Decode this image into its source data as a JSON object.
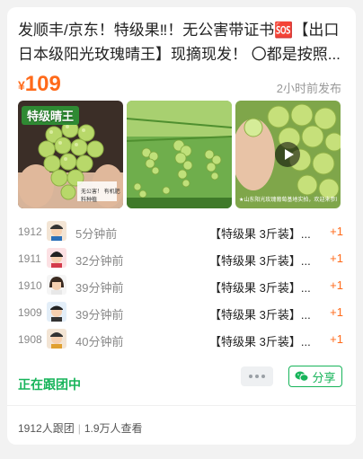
{
  "post": {
    "title": "发顺丰/京东！特级果‼！无公害带证书🆘【出口日本级阳光玫瑰晴王】现摘现发！ 〇都是按照...",
    "price_symbol": "¥",
    "price": "109",
    "posted": "2小时前发布"
  },
  "photos": [
    {
      "tag": "特级晴王",
      "watermark": "无公害！ 有机肥料种植",
      "icon": "grape-bunch-photo"
    },
    {
      "icon": "vineyard-photo"
    },
    {
      "caption": "★山东阳光玫瑰葡萄基地实拍，欢迎来参观",
      "icon": "play-icon"
    }
  ],
  "orders": [
    {
      "no": "1912",
      "time": "5分钟前",
      "item": "【特级果 3斤装】...",
      "qty": "+1"
    },
    {
      "no": "1911",
      "time": "32分钟前",
      "item": "【特级果 3斤装】...",
      "qty": "+1"
    },
    {
      "no": "1910",
      "time": "39分钟前",
      "item": "【特级果 3斤装】...",
      "qty": "+1"
    },
    {
      "no": "1909",
      "time": "39分钟前",
      "item": "【特级果 3斤装】...",
      "qty": "+1"
    },
    {
      "no": "1908",
      "time": "40分钟前",
      "item": "【特级果 3斤装】...",
      "qty": "+1"
    }
  ],
  "footer": {
    "status": "正在跟团中",
    "share_label": "分享",
    "members": "1912人跟团",
    "views": "1.9万人查看"
  },
  "colors": {
    "accent": "#ff6a1a",
    "green": "#17b45a"
  }
}
